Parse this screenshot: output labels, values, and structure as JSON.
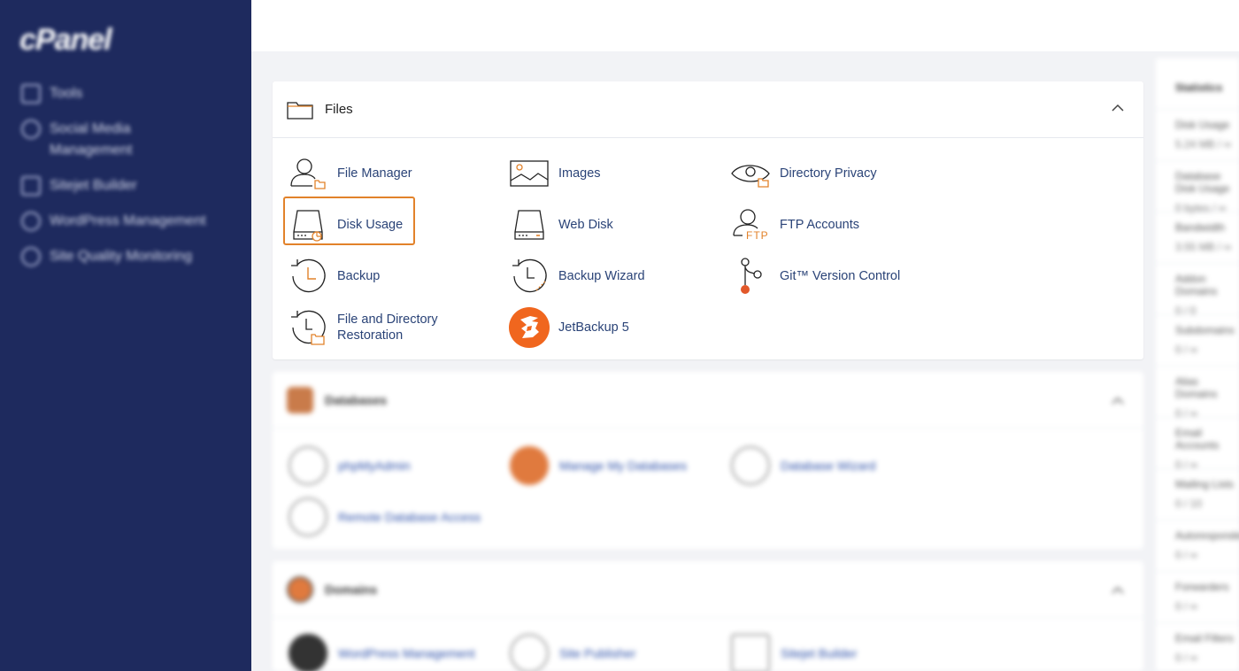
{
  "sidebar": {
    "logo": "cPanel",
    "items": [
      {
        "label": "Tools",
        "icon": "tools-icon"
      },
      {
        "label": "Social Media Management",
        "icon": "social-media-icon"
      },
      {
        "label": "Sitejet Builder",
        "icon": "sitejet-icon"
      },
      {
        "label": "WordPress Management",
        "icon": "wordpress-icon"
      },
      {
        "label": "Site Quality Monitoring",
        "icon": "site-quality-icon"
      }
    ]
  },
  "files": {
    "title": "Files",
    "items": [
      {
        "label": "File Manager",
        "icon": "file-manager-icon"
      },
      {
        "label": "Images",
        "icon": "images-icon"
      },
      {
        "label": "Directory Privacy",
        "icon": "directory-privacy-icon"
      },
      {
        "label": "Disk Usage",
        "icon": "disk-usage-icon"
      },
      {
        "label": "Web Disk",
        "icon": "web-disk-icon"
      },
      {
        "label": "FTP Accounts",
        "icon": "ftp-accounts-icon",
        "badge": "FTP"
      },
      {
        "label": "Backup",
        "icon": "backup-icon"
      },
      {
        "label": "Backup Wizard",
        "icon": "backup-wizard-icon"
      },
      {
        "label": "Git™ Version Control",
        "icon": "git-icon"
      },
      {
        "label": "File and Directory Restoration",
        "icon": "restoration-icon"
      },
      {
        "label": "JetBackup 5",
        "icon": "jetbackup-icon"
      }
    ]
  },
  "databases": {
    "title": "Databases",
    "items": [
      {
        "label": "phpMyAdmin"
      },
      {
        "label": "Manage My Databases"
      },
      {
        "label": "Database Wizard"
      },
      {
        "label": "Remote Database Access"
      }
    ]
  },
  "domains": {
    "title": "Domains",
    "items": [
      {
        "label": "WordPress Management"
      },
      {
        "label": "Site Publisher"
      },
      {
        "label": "Sitejet Builder"
      }
    ]
  },
  "stats": {
    "title": "Statistics",
    "rows": [
      {
        "label": "Disk Usage",
        "value": "5.24 MB / ∞"
      },
      {
        "label": "Database Disk Usage",
        "value": "0 bytes / ∞"
      },
      {
        "label": "Bandwidth",
        "value": "3.55 MB / ∞"
      },
      {
        "label": "Addon Domains",
        "value": "0 / 0"
      },
      {
        "label": "Subdomains",
        "value": "0 / ∞"
      },
      {
        "label": "Alias Domains",
        "value": "0 / ∞"
      },
      {
        "label": "Email Accounts",
        "value": "0 / ∞"
      },
      {
        "label": "Mailing Lists",
        "value": "0 / 10"
      },
      {
        "label": "Autoresponders",
        "value": "0 / ∞"
      },
      {
        "label": "Forwarders",
        "value": "0 / ∞"
      },
      {
        "label": "Email Filters",
        "value": "0 / ∞"
      }
    ]
  },
  "colors": {
    "sidebar": "#1e2a5e",
    "accent": "#e2822a",
    "link": "#2a4377"
  }
}
